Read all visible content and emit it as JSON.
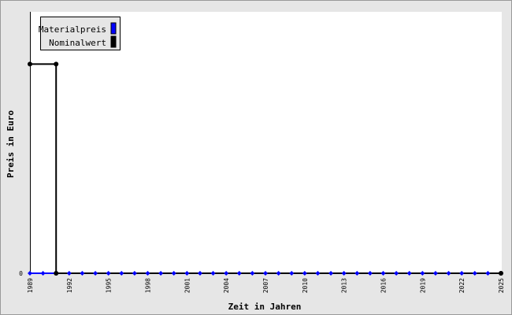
{
  "chart_data": {
    "type": "line",
    "title": "",
    "xlabel": "Zeit in Jahren",
    "ylabel": "Preis in Euro",
    "x_tick_labels": [
      "1989",
      "1992",
      "1995",
      "1998",
      "2001",
      "2004",
      "2007",
      "2010",
      "2013",
      "2016",
      "2019",
      "2022",
      "2025"
    ],
    "y_tick_labels": [
      "0"
    ],
    "xlim": [
      1989,
      2025
    ],
    "x": [
      1989,
      1990,
      1991,
      1992,
      1993,
      1994,
      1995,
      1996,
      1997,
      1998,
      1999,
      2000,
      2001,
      2002,
      2003,
      2004,
      2005,
      2006,
      2007,
      2008,
      2009,
      2010,
      2011,
      2012,
      2013,
      2014,
      2015,
      2016,
      2017,
      2018,
      2019,
      2020,
      2021,
      2022,
      2023,
      2024,
      2025
    ],
    "legend_position": "top-left",
    "grid": false,
    "series": [
      {
        "name": "Materialpreis",
        "color": "#0000ff",
        "values": [
          0,
          0,
          0,
          0,
          0,
          0,
          0,
          0,
          0,
          0,
          0,
          0,
          0,
          0,
          0,
          0,
          0,
          0,
          0,
          0,
          0,
          0,
          0,
          0,
          0,
          0,
          0,
          0,
          0,
          0,
          0,
          0,
          0,
          0,
          0,
          0,
          0
        ]
      },
      {
        "name": "Nominalwert",
        "color": "#000000",
        "step": true,
        "points": [
          [
            1989,
            1
          ],
          [
            1991,
            1
          ],
          [
            1991,
            0
          ],
          [
            2025,
            0
          ]
        ]
      }
    ],
    "ylim": [
      0,
      1.25
    ]
  }
}
